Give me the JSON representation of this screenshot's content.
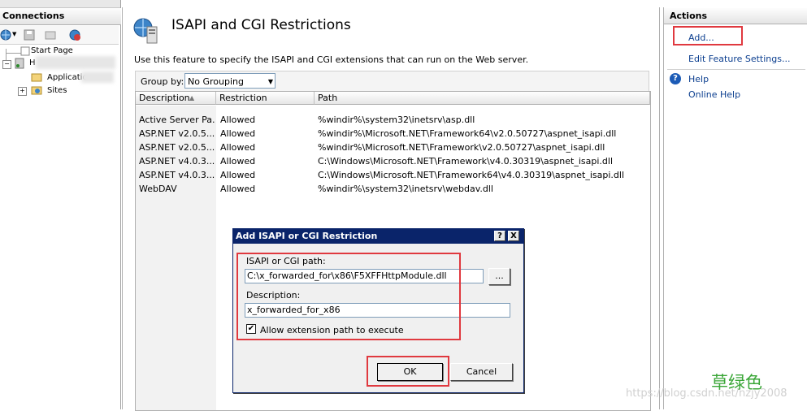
{
  "connections": {
    "header": "Connections",
    "tree": [
      {
        "label": "Start Page"
      },
      {
        "label": "H"
      },
      {
        "label": "Applicatio"
      },
      {
        "label": "Sites"
      }
    ]
  },
  "main": {
    "title": "ISAPI and CGI Restrictions",
    "description": "Use this feature to specify the ISAPI and CGI extensions that can run on the Web server.",
    "group_by_label": "Group by:",
    "group_by_value": "No Grouping",
    "columns": [
      "Description",
      "Restriction",
      "Path"
    ],
    "rows": [
      {
        "description": "Active Server Pa...",
        "restriction": "Allowed",
        "path": "%windir%\\system32\\inetsrv\\asp.dll"
      },
      {
        "description": "ASP.NET v2.0.5...",
        "restriction": "Allowed",
        "path": "%windir%\\Microsoft.NET\\Framework64\\v2.0.50727\\aspnet_isapi.dll"
      },
      {
        "description": "ASP.NET v2.0.5...",
        "restriction": "Allowed",
        "path": "%windir%\\Microsoft.NET\\Framework\\v2.0.50727\\aspnet_isapi.dll"
      },
      {
        "description": "ASP.NET v4.0.3...",
        "restriction": "Allowed",
        "path": "C:\\Windows\\Microsoft.NET\\Framework\\v4.0.30319\\aspnet_isapi.dll"
      },
      {
        "description": "ASP.NET v4.0.3...",
        "restriction": "Allowed",
        "path": "C:\\Windows\\Microsoft.NET\\Framework64\\v4.0.30319\\aspnet_isapi.dll"
      },
      {
        "description": "WebDAV",
        "restriction": "Allowed",
        "path": "%windir%\\system32\\inetsrv\\webdav.dll"
      }
    ]
  },
  "actions": {
    "header": "Actions",
    "add": "Add...",
    "edit_feature_settings": "Edit Feature Settings...",
    "help": "Help",
    "online_help": "Online Help"
  },
  "dialog": {
    "title": "Add ISAPI or CGI Restriction",
    "help_btn": "?",
    "close_btn": "X",
    "path_label": "ISAPI or CGI path:",
    "path_value": "C:\\x_forwarded_for\\x86\\F5XFFHttpModule.dll",
    "browse_label": "...",
    "description_label": "Description:",
    "description_value": "x_forwarded_for_x86",
    "allow_label": "Allow extension path to execute",
    "allow_checked": "✔",
    "ok_label": "OK",
    "cancel_label": "Cancel"
  },
  "watermark": {
    "brand": "草绿色",
    "url": "https://blog.csdn.net/nzjy2008"
  },
  "colors": {
    "accent": "#0a246a",
    "annotation": "#e0393f",
    "link": "#0b3e8f"
  }
}
